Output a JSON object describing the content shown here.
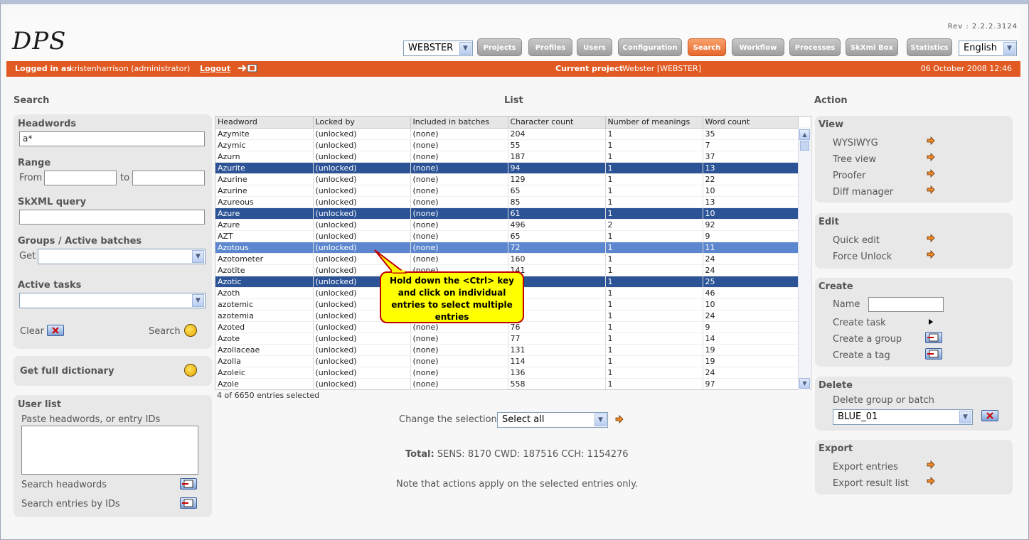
{
  "app": {
    "logo": "DPS",
    "rev": "Rev : 2.2.2.3124",
    "project_select": "WEBSTER",
    "language_select": "English",
    "nav": [
      "Projects",
      "Profiles",
      "Users",
      "Configuration",
      "Search",
      "Workflow",
      "Processes",
      "SkXml Box",
      "Statistics"
    ],
    "active_nav": "Search"
  },
  "status_bar": {
    "logged_in_label": "Logged in as",
    "user": "kristenharrison (administrator)",
    "logout": "Logout",
    "current_project_label": "Current project",
    "current_project": "Webster [WEBSTER]",
    "datetime": "06 October 2008 12:46"
  },
  "search_panel": {
    "heading": "Search",
    "headwords_label": "Headwords",
    "headwords_value": "a*",
    "range_label": "Range",
    "from_label": "From",
    "to_label": "to",
    "skxml_label": "SkXML query",
    "groups_label": "Groups / Active batches",
    "get_label": "Get",
    "active_tasks_label": "Active tasks",
    "clear_label": "Clear",
    "search_label": "Search",
    "full_dictionary_label": "Get full dictionary",
    "user_list_label": "User list",
    "paste_label": "Paste headwords, or entry IDs",
    "search_headwords_label": "Search headwords",
    "search_ids_label": "Search entries by IDs"
  },
  "list": {
    "heading": "List",
    "columns": [
      "Headword",
      "Locked by",
      "Included in batches",
      "Character count",
      "Number of meanings",
      "Word count"
    ],
    "rows": [
      {
        "hw": "Azymite",
        "lock": "(unlocked)",
        "batch": "(none)",
        "cc": "204",
        "nm": "1",
        "wc": "35",
        "state": ""
      },
      {
        "hw": "Azymic",
        "lock": "(unlocked)",
        "batch": "(none)",
        "cc": "55",
        "nm": "1",
        "wc": "7",
        "state": ""
      },
      {
        "hw": "Azurn",
        "lock": "(unlocked)",
        "batch": "(none)",
        "cc": "187",
        "nm": "1",
        "wc": "37",
        "state": ""
      },
      {
        "hw": "Azurite",
        "lock": "(unlocked)",
        "batch": "(none)",
        "cc": "94",
        "nm": "1",
        "wc": "13",
        "state": "dark"
      },
      {
        "hw": "Azurine",
        "lock": "(unlocked)",
        "batch": "(none)",
        "cc": "129",
        "nm": "1",
        "wc": "22",
        "state": ""
      },
      {
        "hw": "Azurine",
        "lock": "(unlocked)",
        "batch": "(none)",
        "cc": "65",
        "nm": "1",
        "wc": "10",
        "state": ""
      },
      {
        "hw": "Azureous",
        "lock": "(unlocked)",
        "batch": "(none)",
        "cc": "85",
        "nm": "1",
        "wc": "13",
        "state": ""
      },
      {
        "hw": "Azure",
        "lock": "(unlocked)",
        "batch": "(none)",
        "cc": "61",
        "nm": "1",
        "wc": "10",
        "state": "dark"
      },
      {
        "hw": "Azure",
        "lock": "(unlocked)",
        "batch": "(none)",
        "cc": "496",
        "nm": "2",
        "wc": "92",
        "state": ""
      },
      {
        "hw": "AZT",
        "lock": "(unlocked)",
        "batch": "(none)",
        "cc": "65",
        "nm": "1",
        "wc": "9",
        "state": ""
      },
      {
        "hw": "Azotous",
        "lock": "(unlocked)",
        "batch": "(none)",
        "cc": "72",
        "nm": "1",
        "wc": "11",
        "state": "light"
      },
      {
        "hw": "Azotometer",
        "lock": "(unlocked)",
        "batch": "(none)",
        "cc": "160",
        "nm": "1",
        "wc": "24",
        "state": ""
      },
      {
        "hw": "Azotite",
        "lock": "(unlocked)",
        "batch": "(none)",
        "cc": "141",
        "nm": "1",
        "wc": "24",
        "state": ""
      },
      {
        "hw": "Azotic",
        "lock": "(unlocked)",
        "batch": "",
        "cc": "",
        "nm": "1",
        "wc": "25",
        "state": "dark"
      },
      {
        "hw": "Azoth",
        "lock": "(unlocked)",
        "batch": "",
        "cc": "",
        "nm": "1",
        "wc": "46",
        "state": ""
      },
      {
        "hw": "azotemic",
        "lock": "(unlocked)",
        "batch": "",
        "cc": "",
        "nm": "1",
        "wc": "10",
        "state": ""
      },
      {
        "hw": "azotemia",
        "lock": "(unlocked)",
        "batch": "",
        "cc": "",
        "nm": "1",
        "wc": "24",
        "state": ""
      },
      {
        "hw": "Azoted",
        "lock": "(unlocked)",
        "batch": "(none)",
        "cc": "76",
        "nm": "1",
        "wc": "9",
        "state": ""
      },
      {
        "hw": "Azote",
        "lock": "(unlocked)",
        "batch": "(none)",
        "cc": "77",
        "nm": "1",
        "wc": "14",
        "state": ""
      },
      {
        "hw": "Azollaceae",
        "lock": "(unlocked)",
        "batch": "(none)",
        "cc": "131",
        "nm": "1",
        "wc": "19",
        "state": ""
      },
      {
        "hw": "Azolla",
        "lock": "(unlocked)",
        "batch": "(none)",
        "cc": "114",
        "nm": "1",
        "wc": "19",
        "state": ""
      },
      {
        "hw": "Azoleic",
        "lock": "(unlocked)",
        "batch": "(none)",
        "cc": "136",
        "nm": "1",
        "wc": "24",
        "state": ""
      },
      {
        "hw": "Azole",
        "lock": "(unlocked)",
        "batch": "(none)",
        "cc": "558",
        "nm": "1",
        "wc": "97",
        "state": ""
      }
    ],
    "selected_count": "4 of 6650 entries selected",
    "change_selection_label": "Change the selection",
    "change_selection_value": "Select all",
    "total_label": "Total:",
    "total_value": "SENS: 8170 CWD: 187516 CCH: 1154276",
    "note": "Note that actions apply on the selected entries only.",
    "callout": "Hold down the <Ctrl> key and click on individual entries to select multiple entries"
  },
  "action_panel": {
    "heading": "Action",
    "view_title": "View",
    "view_items": [
      "WYSIWYG",
      "Tree view",
      "Proofer",
      "Diff manager"
    ],
    "edit_title": "Edit",
    "edit_items": [
      "Quick edit",
      "Force Unlock"
    ],
    "create_title": "Create",
    "name_label": "Name",
    "create_items": [
      "Create task",
      "Create a group",
      "Create a tag"
    ],
    "delete_title": "Delete",
    "delete_label": "Delete group or batch",
    "delete_select": "BLUE_01",
    "export_title": "Export",
    "export_items": [
      "Export entries",
      "Export result list"
    ]
  }
}
